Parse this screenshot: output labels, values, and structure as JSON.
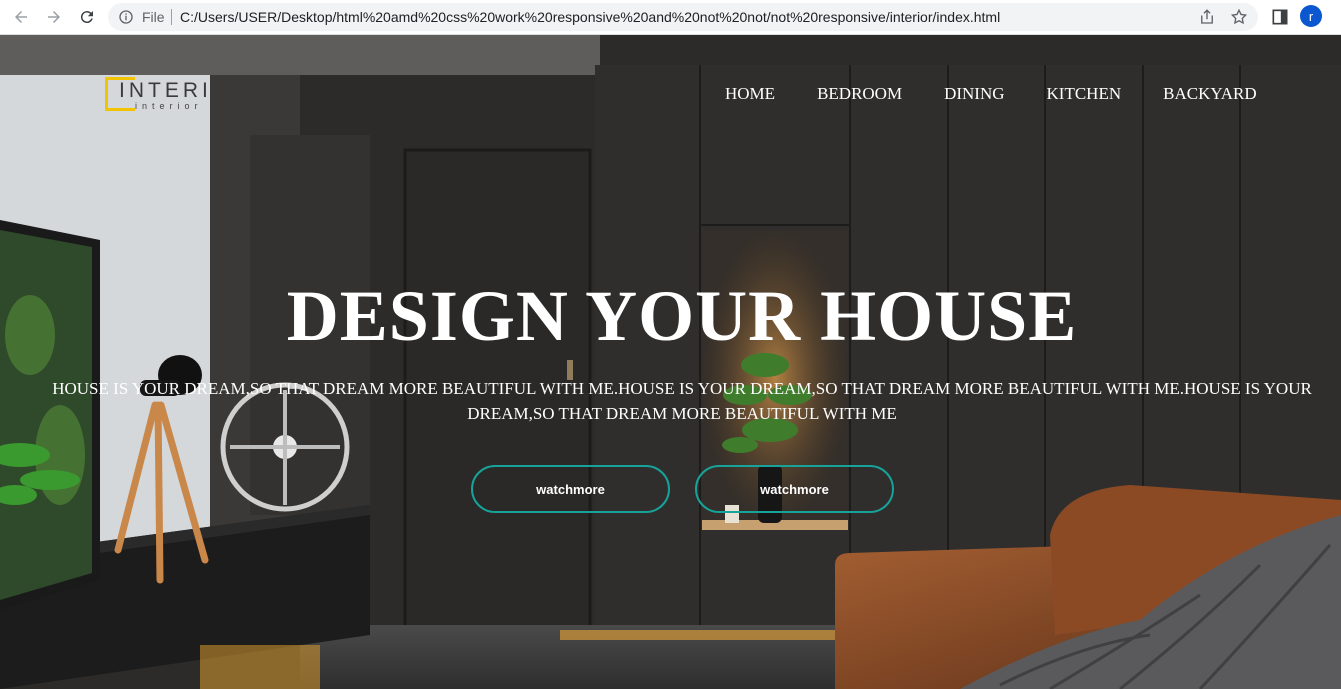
{
  "browser": {
    "file_label": "File",
    "url": "C:/Users/USER/Desktop/html%20amd%20css%20work%20responsive%20and%20not%20not/not%20responsive/interior/index.html",
    "profile_initial": "r"
  },
  "logo": {
    "main": "INTERIO",
    "sub": "interior"
  },
  "nav": {
    "items": [
      "HOME",
      "BEDROOM",
      "DINING",
      "KITCHEN",
      "BACKYARD"
    ]
  },
  "hero": {
    "headline": "DESIGN YOUR HOUSE",
    "tagline": "HOUSE IS YOUR DREAM,SO THAT DREAM MORE BEAUTIFUL WITH ME.HOUSE IS YOUR DREAM,SO THAT DREAM MORE BEAUTIFUL WITH ME.HOUSE IS YOUR DREAM,SO THAT DREAM MORE BEAUTIFUL WITH ME",
    "buttons": [
      "watchmore",
      "watchmore"
    ]
  },
  "colors": {
    "accent_yellow": "#f2c300",
    "button_border": "#16a39a",
    "wall_dark": "#2c2a28"
  }
}
